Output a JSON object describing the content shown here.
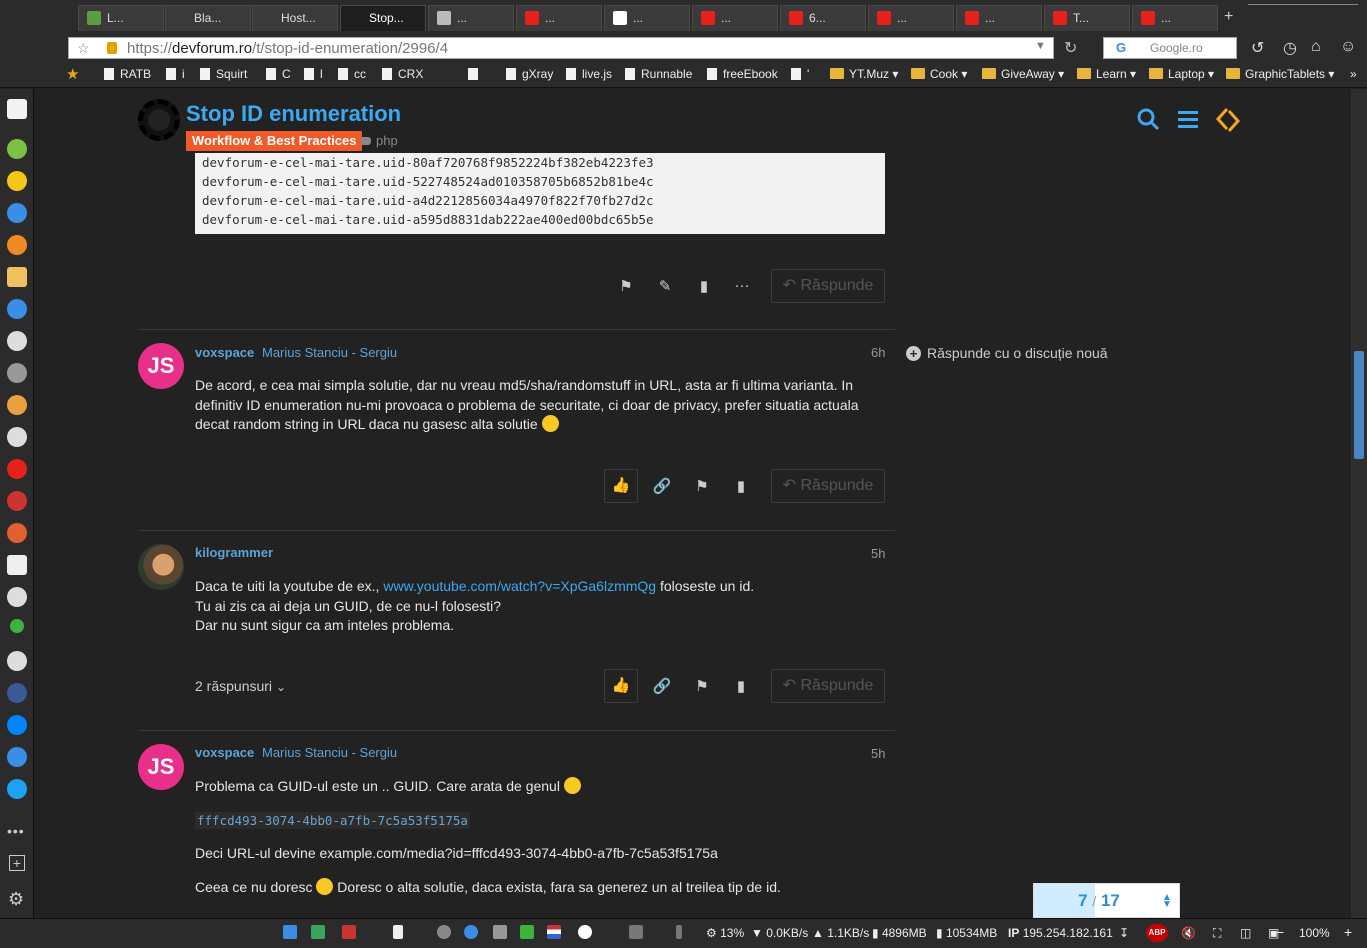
{
  "browser": {
    "tabs": [
      {
        "label": "L...",
        "color": "#5b9e3c"
      },
      {
        "label": "Bla...",
        "color": ""
      },
      {
        "label": "Host...",
        "color": ""
      },
      {
        "label": "Stop...",
        "color": ""
      },
      {
        "label": "...",
        "color": "#bbbbbb"
      },
      {
        "label": "...",
        "color": "#e62117"
      },
      {
        "label": "...",
        "color": "#ffffff"
      },
      {
        "label": "...",
        "color": "#e62117"
      },
      {
        "label": "6...",
        "color": "#e62117"
      },
      {
        "label": "...",
        "color": "#e62117"
      },
      {
        "label": "...",
        "color": "#e62117"
      },
      {
        "label": "T...",
        "color": "#e62117"
      },
      {
        "label": "...",
        "color": "#e62117"
      }
    ],
    "new_tab": "+",
    "url_prefix": "https://",
    "url_domain": "devforum.ro",
    "url_path": "/t/stop-id-enumeration/2996/4",
    "search_engine": "G",
    "search_placeholder": "Google.ro",
    "bookmarks": [
      "RATB",
      "i",
      "Squirt",
      "C",
      "l",
      "cc",
      "CRX",
      "",
      "gXray",
      "live.js",
      "Runnable",
      "freeEbook",
      "'",
      "YT.Muz",
      "Cook",
      "GiveAway",
      "Learn",
      "Laptop",
      "GraphicTablets"
    ],
    "bookmark_more": "»"
  },
  "forum": {
    "topic_title": "Stop ID enumeration",
    "category": "Workflow & Best Practices",
    "category_color": "#f05a28",
    "tag": "php",
    "code_lines": [
      "devforum-e-cel-mai-tare.uid-80af720768f9852224bf382eb4223fe3",
      "devforum-e-cel-mai-tare.uid-522748524ad010358705b6852b81be4c",
      "devforum-e-cel-mai-tare.uid-a4d2212856034a4970f822f70fb27d2c",
      "devforum-e-cel-mai-tare.uid-a595d8831dab222ae400ed00bdc65b5e"
    ],
    "reply_label": "Răspunde",
    "side_reply": "Răspunde cu o discuție nouă",
    "posts": [
      {
        "avatar": "JS",
        "username": "voxspace",
        "fullname": "Marius Stanciu - Sergiu",
        "time": "6h",
        "text": "De acord, e cea mai simpla solutie, dar nu vreau md5/sha/randomstuff in URL, asta ar fi ultima varianta. In definitiv ID enumeration nu-mi provoaca o problema de securitate, ci doar de privacy, prefer situatia actuala decat random string in URL daca nu gasesc alta solutie"
      },
      {
        "username": "kilogrammer",
        "time": "5h",
        "text_before_link": "Daca te uiti la youtube de ex., ",
        "link": "www.youtube.com/watch?v=XpGa6lzmmQg",
        "text_after_link": " foloseste un id.",
        "line2": "Tu ai zis ca ai deja un GUID, de ce nu-l folosesti?",
        "line3": "Dar nu sunt sigur ca am inteles problema.",
        "replies": "2 răspunsuri"
      },
      {
        "avatar": "JS",
        "username": "voxspace",
        "fullname": "Marius Stanciu - Sergiu",
        "time": "5h",
        "p1": "Problema ca GUID-ul este un .. GUID. Care arata de genul",
        "code": "fffcd493-3074-4bb0-a7fb-7c5a53f5175a",
        "p2": "Deci URL-ul devine example.com/media?id=fffcd493-3074-4bb0-a7fb-7c5a53f5175a",
        "p3_before": "Ceea ce nu doresc",
        "p3_after": " Doresc o alta solutie, daca exista, fara sa generez un al treilea tip de id."
      }
    ],
    "progress": {
      "current": "7",
      "separator": "/",
      "total": "17",
      "fraction": 0.42
    }
  },
  "statusbar": {
    "cpu": "13%",
    "down": "0.0KB/s",
    "up": "1.1KB/s",
    "mem1": "4896MB",
    "mem2": "10534MB",
    "ip_label": "IP",
    "ip": "195.254.182.161",
    "abp": "ABP",
    "zoom_minus": "−",
    "zoom": "100%",
    "zoom_plus": "+"
  }
}
